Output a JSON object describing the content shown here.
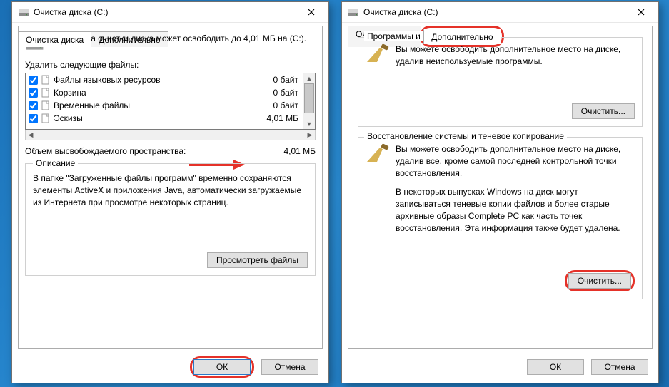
{
  "colors": {
    "highlight": "#e53229",
    "accent": "#3390d8"
  },
  "dialog1": {
    "title": "Очистка диска  (C:)",
    "tabs": {
      "cleanup": "Очистка диска",
      "more": "Дополнительно"
    },
    "intro": "Программа очистки диска может освободить до 4,01 МБ на  (C:).",
    "list_label": "Удалить следующие файлы:",
    "files": [
      {
        "name": "Файлы языковых ресурсов",
        "size": "0 байт",
        "checked": true
      },
      {
        "name": "Корзина",
        "size": "0 байт",
        "checked": true
      },
      {
        "name": "Временные файлы",
        "size": "0 байт",
        "checked": true
      },
      {
        "name": "Эскизы",
        "size": "4,01 МБ",
        "checked": true
      }
    ],
    "total_label": "Объем высвобождаемого пространства:",
    "total_value": "4,01 МБ",
    "desc_title": "Описание",
    "desc_text": "В папке \"Загруженные файлы программ\" временно сохраняются элементы ActiveX и приложения Java, автоматически загружаемые из Интернета при просмотре некоторых страниц.",
    "view_files_btn": "Просмотреть файлы",
    "ok_btn": "ОК",
    "cancel_btn": "Отмена"
  },
  "dialog2": {
    "title": "Очистка диска  (C:)",
    "tabs": {
      "cleanup": "Очистка диска",
      "more": "Дополнительно"
    },
    "group1": {
      "title": "Программы и компоненты",
      "text": "Вы можете освободить дополнительное место на диске, удалив неиспользуемые программы.",
      "btn": "Очистить..."
    },
    "group2": {
      "title": "Восстановление системы и теневое копирование",
      "text1": "Вы можете освободить дополнительное место на диске, удалив все, кроме самой последней контрольной точки восстановления.",
      "text2": "В некоторых выпусках Windows на диск могут записываться теневые копии файлов и более старые архивные образы Complete PC как часть точек восстановления. Эта информация также будет удалена.",
      "btn": "Очистить..."
    },
    "ok_btn": "ОК",
    "cancel_btn": "Отмена"
  }
}
